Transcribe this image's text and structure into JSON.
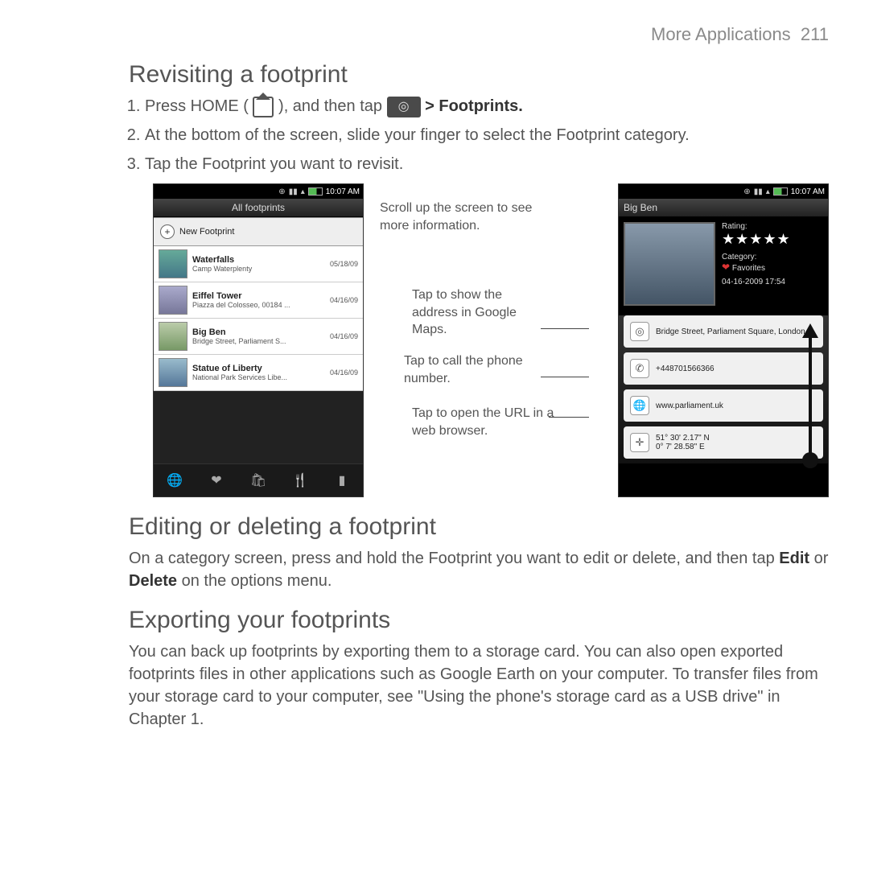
{
  "header": {
    "section": "More Applications",
    "page_num": "211"
  },
  "sec1": {
    "title": "Revisiting a footprint",
    "step1a": "Press HOME (",
    "step1b": "), and then tap",
    "step1c": "> Footprints.",
    "step2": "At the bottom of the screen, slide your finger to select the Footprint category.",
    "step3": "Tap the Footprint you want to revisit."
  },
  "phone_left": {
    "time": "10:07 AM",
    "title": "All footprints",
    "new_label": "New Footprint",
    "items": [
      {
        "title": "Waterfalls",
        "sub": "Camp Waterplenty",
        "date": "05/18/09"
      },
      {
        "title": "Eiffel Tower",
        "sub": "Piazza del Colosseo, 00184 ...",
        "date": "04/16/09"
      },
      {
        "title": "Big Ben",
        "sub": "Bridge Street, Parliament S...",
        "date": "04/16/09"
      },
      {
        "title": "Statue of Liberty",
        "sub": "National Park Services Libe...",
        "date": "04/16/09"
      }
    ]
  },
  "callouts": {
    "scroll": "Scroll up the screen to see more information.",
    "maps": "Tap to show the address in Google Maps.",
    "phone": "Tap to call the phone number.",
    "url": "Tap to open the URL in a web browser."
  },
  "phone_right": {
    "time": "10:07 AM",
    "title": "Big Ben",
    "rating_label": "Rating:",
    "stars": "★★★★★",
    "category_label": "Category:",
    "category_value": "Favorites",
    "timestamp": "04-16-2009 17:54",
    "address": "Bridge Street, Parliament Square, London",
    "phone": "+448701566366",
    "url": "www.parliament.uk",
    "coords_lat": "51° 30' 2.17\" N",
    "coords_lon": "0° 7' 28.58\" E"
  },
  "sec2": {
    "title": "Editing or deleting a footprint",
    "body_a": "On a category screen, press and hold the Footprint you want to edit or delete, and then tap ",
    "edit": "Edit",
    "or": " or ",
    "delete": "Delete",
    "body_b": " on the options menu."
  },
  "sec3": {
    "title": "Exporting your footprints",
    "body": "You can back up footprints by exporting them to a storage card. You can also open exported footprints files in other applications such as Google Earth on your computer. To transfer files from your storage card to your computer, see \"Using the phone's storage card as a USB drive\" in Chapter 1."
  }
}
